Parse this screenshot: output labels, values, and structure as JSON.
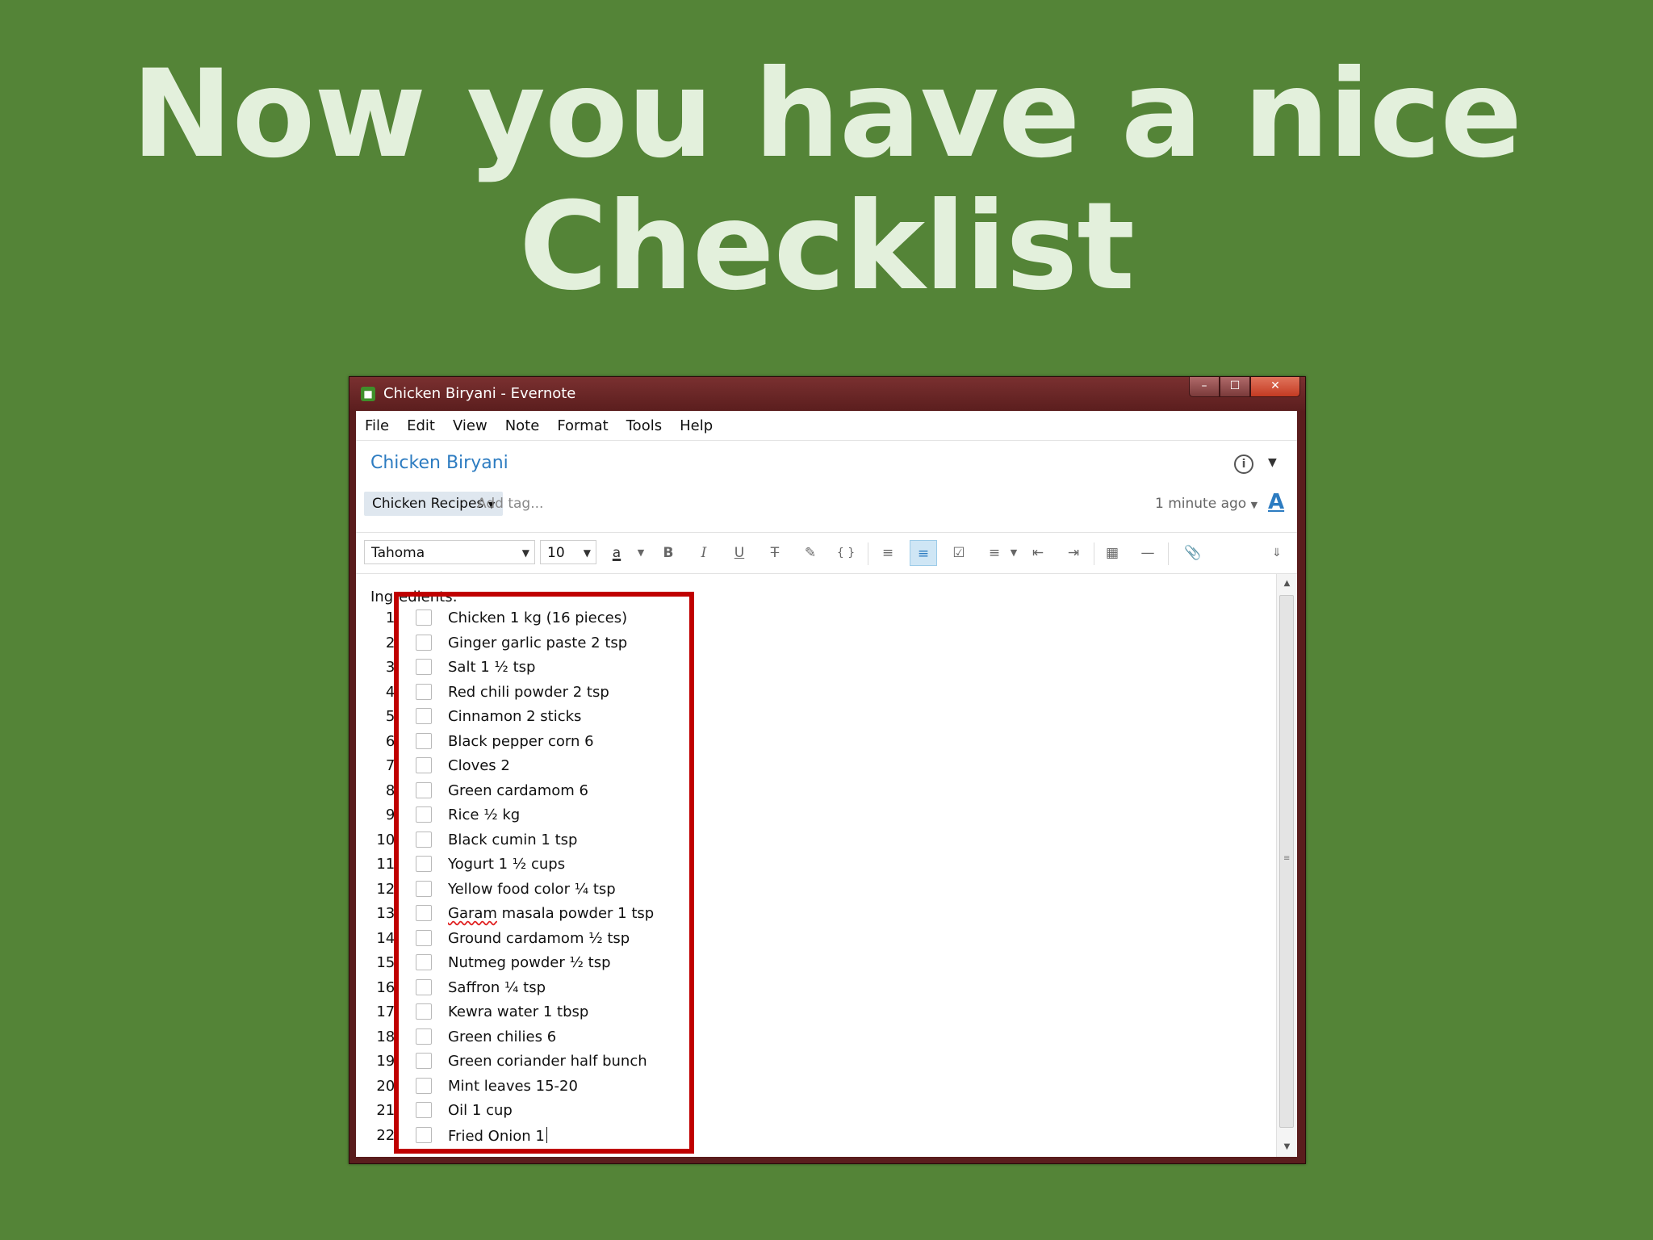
{
  "slide": {
    "title_line1": "Now you have a nice",
    "title_line2": "Checklist"
  },
  "window": {
    "title": "Chicken Biryani - Evernote",
    "controls": {
      "minimize": "–",
      "maximize": "☐",
      "close": "✕"
    }
  },
  "menu": [
    "File",
    "Edit",
    "View",
    "Note",
    "Format",
    "Tools",
    "Help"
  ],
  "note": {
    "title": "Chicken Biryani",
    "notebook": "Chicken Recipes",
    "tag_placeholder": "Add tag...",
    "updated": "1 minute ago"
  },
  "toolbar": {
    "font": "Tahoma",
    "size": "10",
    "icons": [
      "font-color-icon",
      "bold-icon",
      "italic-icon",
      "underline-icon",
      "strikethrough-icon",
      "highlighter-icon",
      "code-block-icon",
      "bulleted-list-icon",
      "numbered-list-icon",
      "checkbox-icon",
      "align-icon",
      "outdent-icon",
      "indent-icon",
      "table-icon",
      "horizontal-rule-icon",
      "attachment-icon",
      "more-icon"
    ]
  },
  "content": {
    "heading": "Ingredients:",
    "items": [
      {
        "num": "1.",
        "text": "Chicken 1 kg (16 pieces)",
        "checked": false
      },
      {
        "num": "2.",
        "text": "Ginger garlic paste 2 tsp",
        "checked": false
      },
      {
        "num": "3.",
        "text": "Salt 1 ½ tsp",
        "checked": false
      },
      {
        "num": "4.",
        "text": "Red chili powder 2 tsp",
        "checked": false
      },
      {
        "num": "5.",
        "text": "Cinnamon 2 sticks",
        "checked": false
      },
      {
        "num": "6.",
        "text": "Black pepper corn 6",
        "checked": false
      },
      {
        "num": "7.",
        "text": "Cloves 2",
        "checked": false
      },
      {
        "num": "8.",
        "text": "Green cardamom 6",
        "checked": false
      },
      {
        "num": "9.",
        "text": "Rice ½ kg",
        "checked": false
      },
      {
        "num": "10.",
        "text": "Black cumin 1 tsp",
        "checked": false
      },
      {
        "num": "11.",
        "text": "Yogurt 1 ½ cups",
        "checked": false
      },
      {
        "num": "12.",
        "text": "Yellow food color ¼ tsp",
        "checked": false
      },
      {
        "num": "13.",
        "text": "Garam masala powder 1 tsp",
        "checked": false
      },
      {
        "num": "14.",
        "text": "Ground cardamom ½ tsp",
        "checked": false
      },
      {
        "num": "15.",
        "text": "Nutmeg powder ½ tsp",
        "checked": false
      },
      {
        "num": "16.",
        "text": "Saffron ¼ tsp",
        "checked": false
      },
      {
        "num": "17.",
        "text": "Kewra water 1 tbsp",
        "checked": false
      },
      {
        "num": "18.",
        "text": "Green chilies 6",
        "checked": false
      },
      {
        "num": "19.",
        "text": "Green coriander half bunch",
        "checked": false
      },
      {
        "num": "20.",
        "text": "Mint leaves 15-20",
        "checked": false
      },
      {
        "num": "21.",
        "text": "Oil 1 cup",
        "checked": false
      },
      {
        "num": "22.",
        "text": "Fried Onion 1",
        "checked": false
      }
    ]
  },
  "colors": {
    "background": "#548437",
    "title_text": "#e3f0dc",
    "highlight": "#c00000",
    "link_blue": "#2d7cc1"
  }
}
